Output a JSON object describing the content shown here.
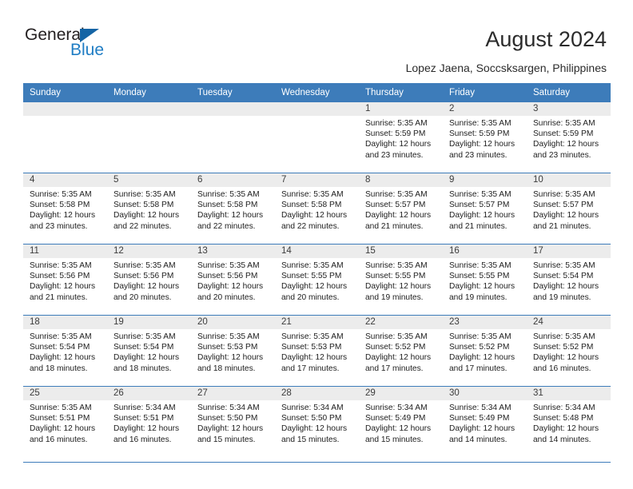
{
  "brand": {
    "name_part1": "General",
    "name_part2": "Blue",
    "logo_icon": "triangle-flag-icon",
    "color_dark": "#231f20",
    "color_blue": "#1f7dc4"
  },
  "header": {
    "title": "August 2024",
    "subtitle": "Lopez Jaena, Soccsksargen, Philippines",
    "accent_color": "#3d7cba"
  },
  "calendar": {
    "weekday_headers": [
      "Sunday",
      "Monday",
      "Tuesday",
      "Wednesday",
      "Thursday",
      "Friday",
      "Saturday"
    ],
    "weeks": [
      [
        {
          "day": "",
          "lines": []
        },
        {
          "day": "",
          "lines": []
        },
        {
          "day": "",
          "lines": []
        },
        {
          "day": "",
          "lines": []
        },
        {
          "day": "1",
          "lines": [
            "Sunrise: 5:35 AM",
            "Sunset: 5:59 PM",
            "Daylight: 12 hours",
            "and 23 minutes."
          ]
        },
        {
          "day": "2",
          "lines": [
            "Sunrise: 5:35 AM",
            "Sunset: 5:59 PM",
            "Daylight: 12 hours",
            "and 23 minutes."
          ]
        },
        {
          "day": "3",
          "lines": [
            "Sunrise: 5:35 AM",
            "Sunset: 5:59 PM",
            "Daylight: 12 hours",
            "and 23 minutes."
          ]
        }
      ],
      [
        {
          "day": "4",
          "lines": [
            "Sunrise: 5:35 AM",
            "Sunset: 5:58 PM",
            "Daylight: 12 hours",
            "and 23 minutes."
          ]
        },
        {
          "day": "5",
          "lines": [
            "Sunrise: 5:35 AM",
            "Sunset: 5:58 PM",
            "Daylight: 12 hours",
            "and 22 minutes."
          ]
        },
        {
          "day": "6",
          "lines": [
            "Sunrise: 5:35 AM",
            "Sunset: 5:58 PM",
            "Daylight: 12 hours",
            "and 22 minutes."
          ]
        },
        {
          "day": "7",
          "lines": [
            "Sunrise: 5:35 AM",
            "Sunset: 5:58 PM",
            "Daylight: 12 hours",
            "and 22 minutes."
          ]
        },
        {
          "day": "8",
          "lines": [
            "Sunrise: 5:35 AM",
            "Sunset: 5:57 PM",
            "Daylight: 12 hours",
            "and 21 minutes."
          ]
        },
        {
          "day": "9",
          "lines": [
            "Sunrise: 5:35 AM",
            "Sunset: 5:57 PM",
            "Daylight: 12 hours",
            "and 21 minutes."
          ]
        },
        {
          "day": "10",
          "lines": [
            "Sunrise: 5:35 AM",
            "Sunset: 5:57 PM",
            "Daylight: 12 hours",
            "and 21 minutes."
          ]
        }
      ],
      [
        {
          "day": "11",
          "lines": [
            "Sunrise: 5:35 AM",
            "Sunset: 5:56 PM",
            "Daylight: 12 hours",
            "and 21 minutes."
          ]
        },
        {
          "day": "12",
          "lines": [
            "Sunrise: 5:35 AM",
            "Sunset: 5:56 PM",
            "Daylight: 12 hours",
            "and 20 minutes."
          ]
        },
        {
          "day": "13",
          "lines": [
            "Sunrise: 5:35 AM",
            "Sunset: 5:56 PM",
            "Daylight: 12 hours",
            "and 20 minutes."
          ]
        },
        {
          "day": "14",
          "lines": [
            "Sunrise: 5:35 AM",
            "Sunset: 5:55 PM",
            "Daylight: 12 hours",
            "and 20 minutes."
          ]
        },
        {
          "day": "15",
          "lines": [
            "Sunrise: 5:35 AM",
            "Sunset: 5:55 PM",
            "Daylight: 12 hours",
            "and 19 minutes."
          ]
        },
        {
          "day": "16",
          "lines": [
            "Sunrise: 5:35 AM",
            "Sunset: 5:55 PM",
            "Daylight: 12 hours",
            "and 19 minutes."
          ]
        },
        {
          "day": "17",
          "lines": [
            "Sunrise: 5:35 AM",
            "Sunset: 5:54 PM",
            "Daylight: 12 hours",
            "and 19 minutes."
          ]
        }
      ],
      [
        {
          "day": "18",
          "lines": [
            "Sunrise: 5:35 AM",
            "Sunset: 5:54 PM",
            "Daylight: 12 hours",
            "and 18 minutes."
          ]
        },
        {
          "day": "19",
          "lines": [
            "Sunrise: 5:35 AM",
            "Sunset: 5:54 PM",
            "Daylight: 12 hours",
            "and 18 minutes."
          ]
        },
        {
          "day": "20",
          "lines": [
            "Sunrise: 5:35 AM",
            "Sunset: 5:53 PM",
            "Daylight: 12 hours",
            "and 18 minutes."
          ]
        },
        {
          "day": "21",
          "lines": [
            "Sunrise: 5:35 AM",
            "Sunset: 5:53 PM",
            "Daylight: 12 hours",
            "and 17 minutes."
          ]
        },
        {
          "day": "22",
          "lines": [
            "Sunrise: 5:35 AM",
            "Sunset: 5:52 PM",
            "Daylight: 12 hours",
            "and 17 minutes."
          ]
        },
        {
          "day": "23",
          "lines": [
            "Sunrise: 5:35 AM",
            "Sunset: 5:52 PM",
            "Daylight: 12 hours",
            "and 17 minutes."
          ]
        },
        {
          "day": "24",
          "lines": [
            "Sunrise: 5:35 AM",
            "Sunset: 5:52 PM",
            "Daylight: 12 hours",
            "and 16 minutes."
          ]
        }
      ],
      [
        {
          "day": "25",
          "lines": [
            "Sunrise: 5:35 AM",
            "Sunset: 5:51 PM",
            "Daylight: 12 hours",
            "and 16 minutes."
          ]
        },
        {
          "day": "26",
          "lines": [
            "Sunrise: 5:34 AM",
            "Sunset: 5:51 PM",
            "Daylight: 12 hours",
            "and 16 minutes."
          ]
        },
        {
          "day": "27",
          "lines": [
            "Sunrise: 5:34 AM",
            "Sunset: 5:50 PM",
            "Daylight: 12 hours",
            "and 15 minutes."
          ]
        },
        {
          "day": "28",
          "lines": [
            "Sunrise: 5:34 AM",
            "Sunset: 5:50 PM",
            "Daylight: 12 hours",
            "and 15 minutes."
          ]
        },
        {
          "day": "29",
          "lines": [
            "Sunrise: 5:34 AM",
            "Sunset: 5:49 PM",
            "Daylight: 12 hours",
            "and 15 minutes."
          ]
        },
        {
          "day": "30",
          "lines": [
            "Sunrise: 5:34 AM",
            "Sunset: 5:49 PM",
            "Daylight: 12 hours",
            "and 14 minutes."
          ]
        },
        {
          "day": "31",
          "lines": [
            "Sunrise: 5:34 AM",
            "Sunset: 5:48 PM",
            "Daylight: 12 hours",
            "and 14 minutes."
          ]
        }
      ]
    ]
  }
}
